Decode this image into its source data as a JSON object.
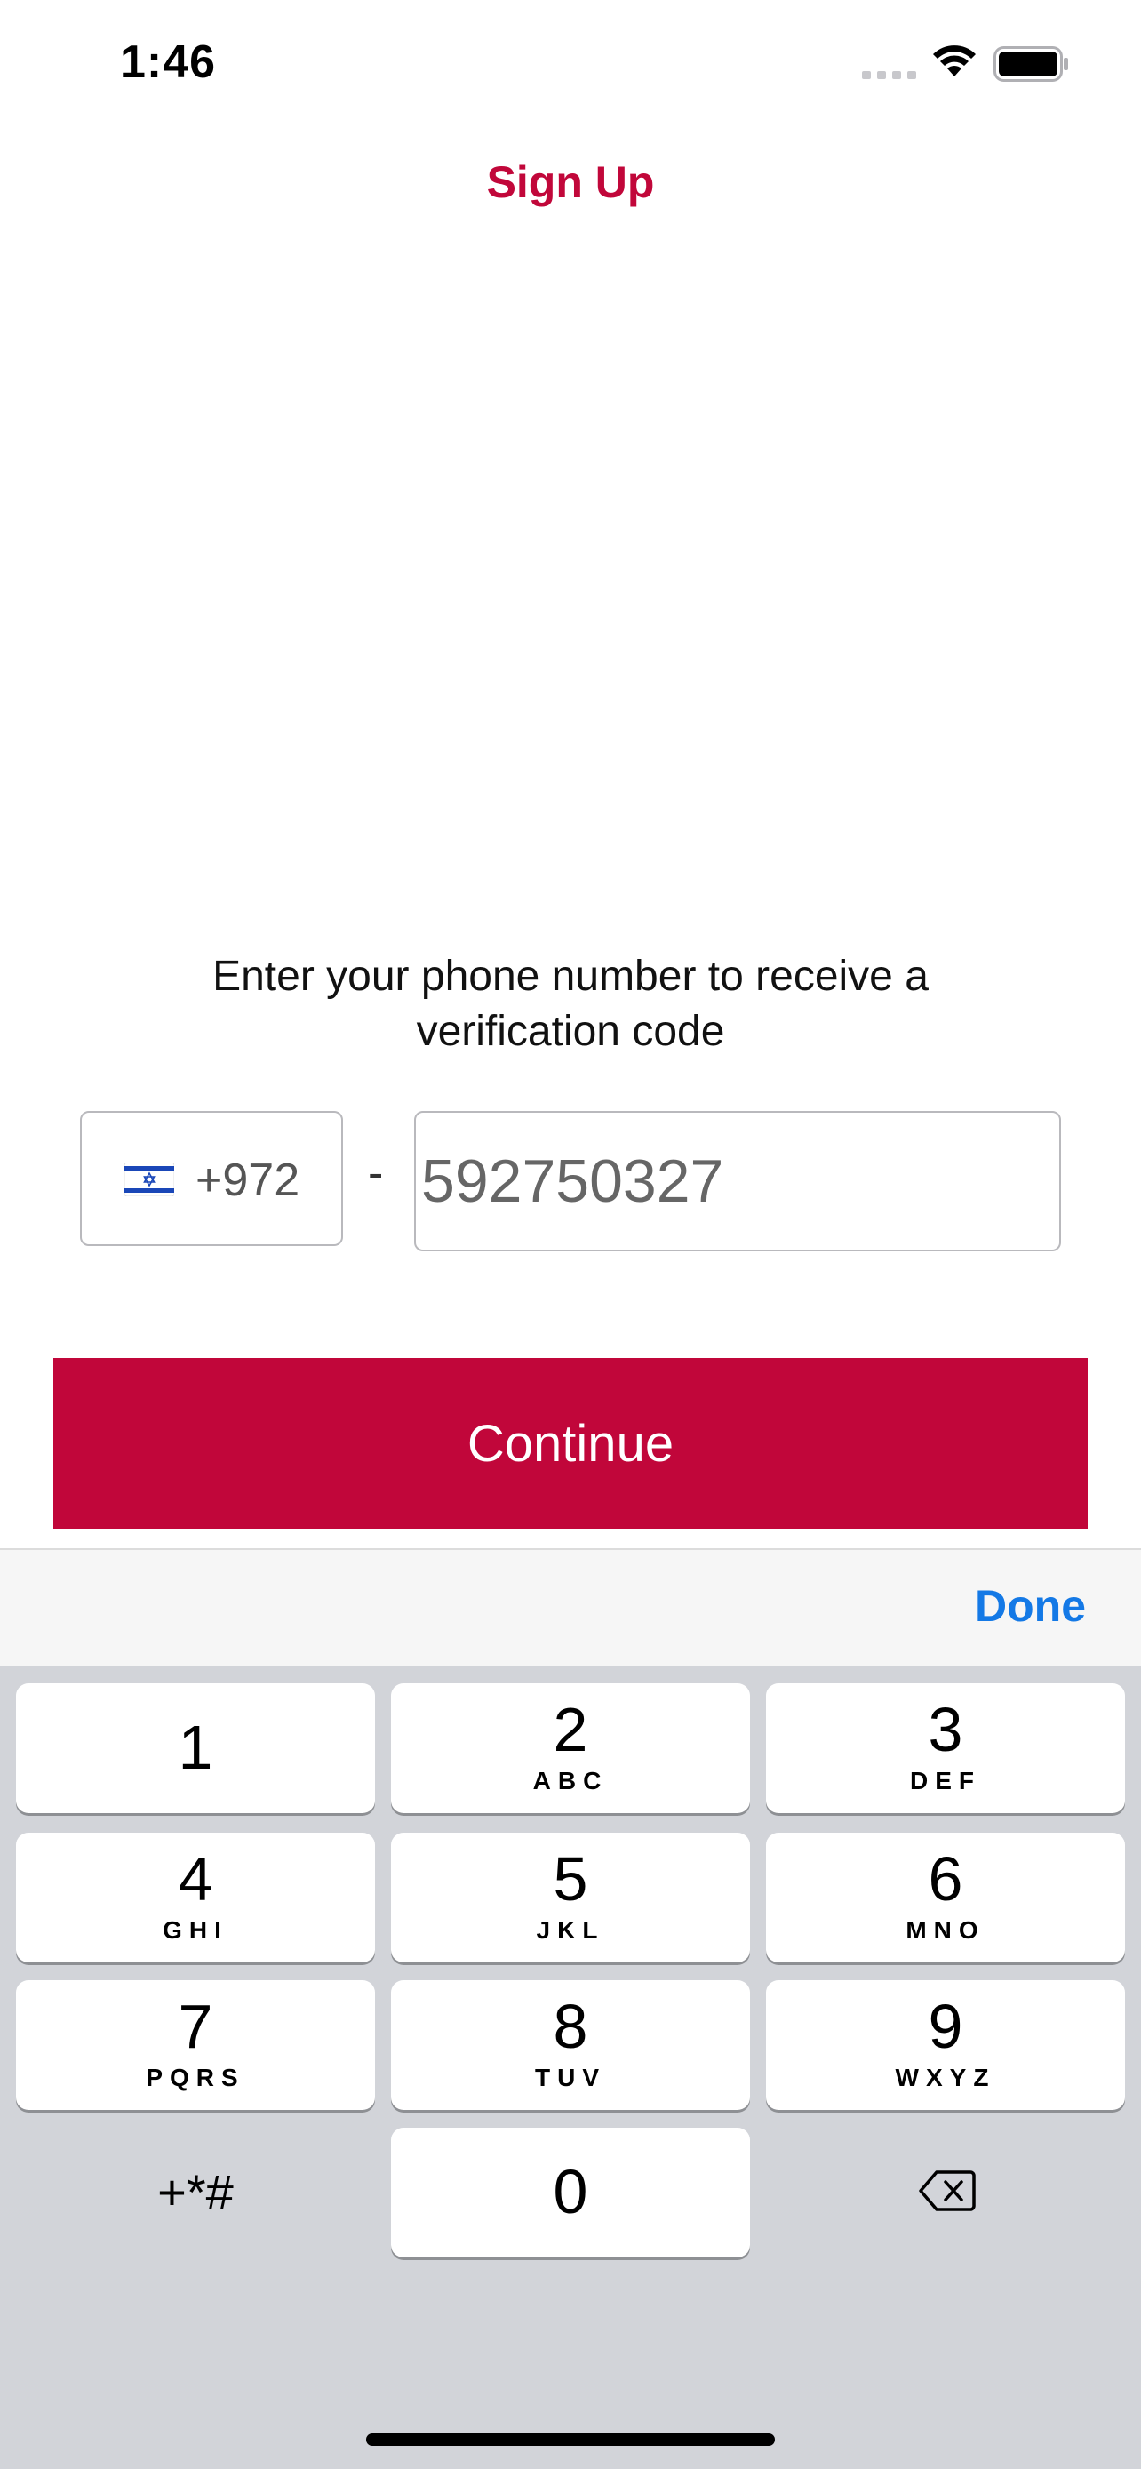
{
  "status_bar": {
    "time": "1:46"
  },
  "nav": {
    "title": "Sign Up"
  },
  "form": {
    "prompt": "Enter your phone number to receive a verification code",
    "country_code": "+972",
    "country_flag": "israel-flag",
    "separator": "-",
    "phone_value": "592750327",
    "continue_label": "Continue"
  },
  "keyboard": {
    "done_label": "Done",
    "keys": [
      {
        "digit": "1",
        "letters": ""
      },
      {
        "digit": "2",
        "letters": "ABC"
      },
      {
        "digit": "3",
        "letters": "DEF"
      },
      {
        "digit": "4",
        "letters": "GHI"
      },
      {
        "digit": "5",
        "letters": "JKL"
      },
      {
        "digit": "6",
        "letters": "MNO"
      },
      {
        "digit": "7",
        "letters": "PQRS"
      },
      {
        "digit": "8",
        "letters": "TUV"
      },
      {
        "digit": "9",
        "letters": "WXYZ"
      },
      {
        "digit": "0",
        "letters": ""
      }
    ],
    "symbols_label": "+*#"
  },
  "colors": {
    "brand": "#c1063a",
    "link": "#1479e6",
    "keyboard_bg": "#d2d4d9"
  }
}
